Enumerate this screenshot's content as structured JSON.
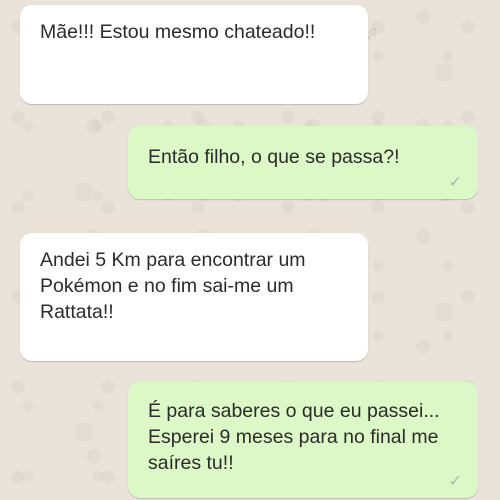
{
  "messages": [
    {
      "direction": "incoming",
      "text": "Mãe!!! Estou mesmo chateado!!"
    },
    {
      "direction": "outgoing",
      "text": "Então filho, o que se passa?!",
      "status_icon": "single-check-icon"
    },
    {
      "direction": "incoming",
      "text": "Andei 5 Km para encontrar um Pokémon e no fim sai-me um Rattata!!"
    },
    {
      "direction": "outgoing",
      "text": "É para saberes o que eu passei... Esperei 9 meses para no final me saíres tu!!",
      "status_icon": "single-check-icon"
    }
  ],
  "colors": {
    "incoming_bubble": "#ffffff",
    "outgoing_bubble": "#dcf8c6",
    "wallpaper": "#e9e3da",
    "check": "#b3b3b3"
  }
}
